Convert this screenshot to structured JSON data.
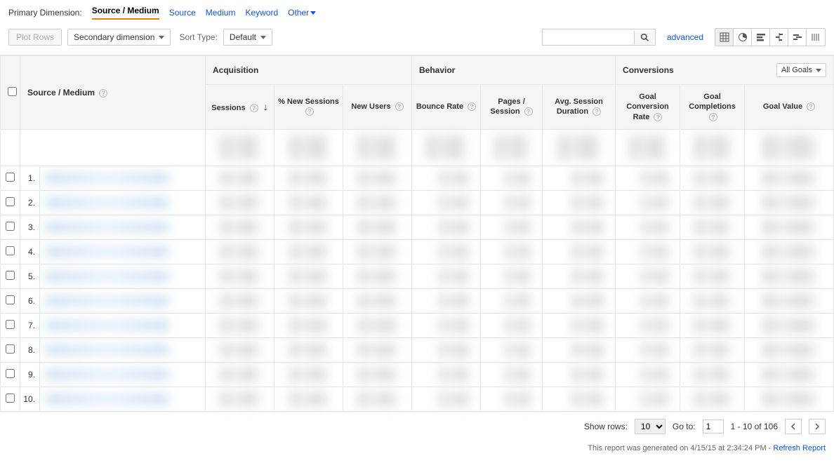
{
  "dimBar": {
    "label": "Primary Dimension:",
    "active": "Source / Medium",
    "links": [
      "Source",
      "Medium",
      "Keyword"
    ],
    "other": "Other"
  },
  "toolbar": {
    "plotRows": "Plot Rows",
    "secondaryDim": "Secondary dimension",
    "sortTypeLabel": "Sort Type:",
    "sortTypeValue": "Default",
    "advanced": "advanced",
    "searchPlaceholder": ""
  },
  "headers": {
    "groups": {
      "dimension": "Source / Medium",
      "acquisition": "Acquisition",
      "behavior": "Behavior",
      "conversions": "Conversions"
    },
    "cols": {
      "sessions": "Sessions",
      "pctNew": "% New Sessions",
      "newUsers": "New Users",
      "bounce": "Bounce Rate",
      "pages": "Pages / Session",
      "duration": "Avg. Session Duration",
      "convRate": "Goal Conversion Rate",
      "completions": "Goal Completions",
      "goalValue": "Goal Value"
    },
    "goalsDropdown": "All Goals"
  },
  "rowNumbers": [
    "1.",
    "2.",
    "3.",
    "4.",
    "5.",
    "6.",
    "7.",
    "8.",
    "9.",
    "10."
  ],
  "footer": {
    "showRows": "Show rows:",
    "rowsValue": "10",
    "goTo": "Go to:",
    "goToValue": "1",
    "range": "1 - 10 of 106"
  },
  "generated": {
    "prefix": "This report was generated on 4/15/15 at 2:34:24 PM - ",
    "refresh": "Refresh Report"
  }
}
